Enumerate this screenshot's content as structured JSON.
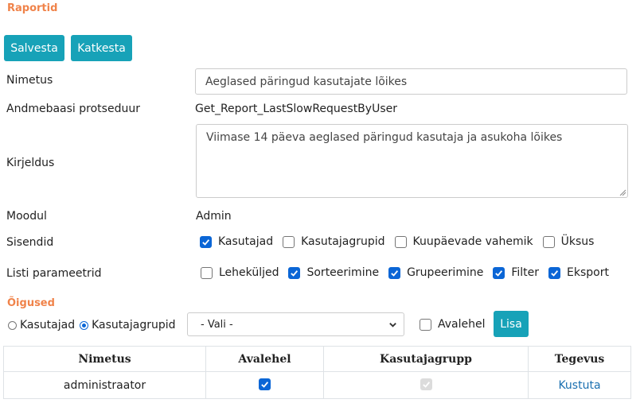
{
  "page": {
    "title": "Raportid",
    "save_label": "Salvesta",
    "cancel_label": "Katkesta"
  },
  "form": {
    "name_label": "Nimetus",
    "name_value": "Aeglased päringud kasutajate lõikes",
    "procedure_label": "Andmebaasi protseduur",
    "procedure_value": "Get_Report_LastSlowRequestByUser",
    "description_label": "Kirjeldus",
    "description_value": "Viimase 14 päeva aeglased päringud kasutaja ja asukoha lõikes",
    "module_label": "Moodul",
    "module_value": "Admin",
    "inputs_label": "Sisendid",
    "inputs": [
      {
        "label": "Kasutajad",
        "checked": true
      },
      {
        "label": "Kasutajagrupid",
        "checked": false
      },
      {
        "label": "Kuupäevade vahemik",
        "checked": false
      },
      {
        "label": "Üksus",
        "checked": false
      }
    ],
    "list_params_label": "Listi parameetrid",
    "list_params": [
      {
        "label": "Leheküljed",
        "checked": false
      },
      {
        "label": "Sorteerimine",
        "checked": true
      },
      {
        "label": "Grupeerimine",
        "checked": true
      },
      {
        "label": "Filter",
        "checked": true
      },
      {
        "label": "Eksport",
        "checked": true
      }
    ]
  },
  "permissions": {
    "title": "Õigused",
    "radio_users_label": "Kasutajad",
    "radio_groups_label": "Kasutajagrupid",
    "selected_radio": "groups",
    "select_value": "- Vali -",
    "homepage_label": "Avalehel",
    "homepage_checked": false,
    "add_label": "Lisa",
    "table": {
      "headers": [
        "Nimetus",
        "Avalehel",
        "Kasutajagrupp",
        "Tegevus"
      ],
      "rows": [
        {
          "name": "administraator",
          "homepage": true,
          "group": true,
          "action": "Kustuta"
        }
      ]
    }
  },
  "colors": {
    "accent": "#17a2b8",
    "section_title": "#f0834a",
    "checkbox_checked": "#0b66d6",
    "link": "#1a6fb0"
  }
}
